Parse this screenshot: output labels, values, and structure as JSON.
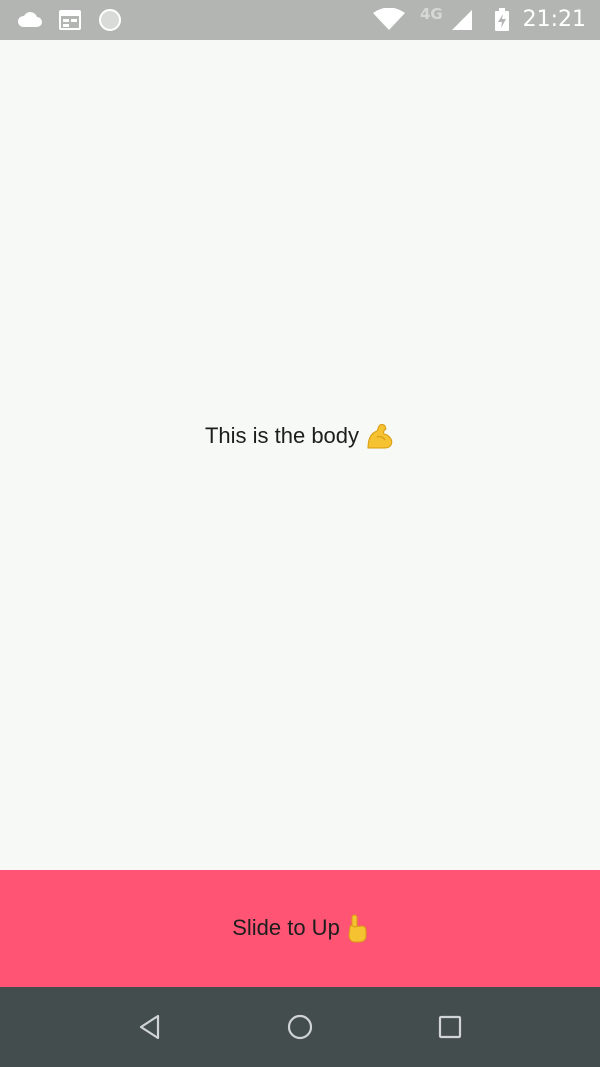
{
  "status_bar": {
    "time": "21:21",
    "network_label": "4G",
    "icons": [
      "cloud-icon",
      "calendar-icon",
      "circle-icon",
      "wifi-icon",
      "signal-icon",
      "battery-charging-icon"
    ],
    "background": "#b3b5b3"
  },
  "body": {
    "text": "This is the body",
    "emoji": "flexed-biceps-icon",
    "background": "#f7f9f7"
  },
  "slide_panel": {
    "text": "Slide to Up",
    "emoji": "pointing-up-icon",
    "background": "#ff5474"
  },
  "nav_bar": {
    "buttons": [
      "back-icon",
      "home-icon",
      "recents-icon"
    ],
    "background": "#444d4d"
  }
}
